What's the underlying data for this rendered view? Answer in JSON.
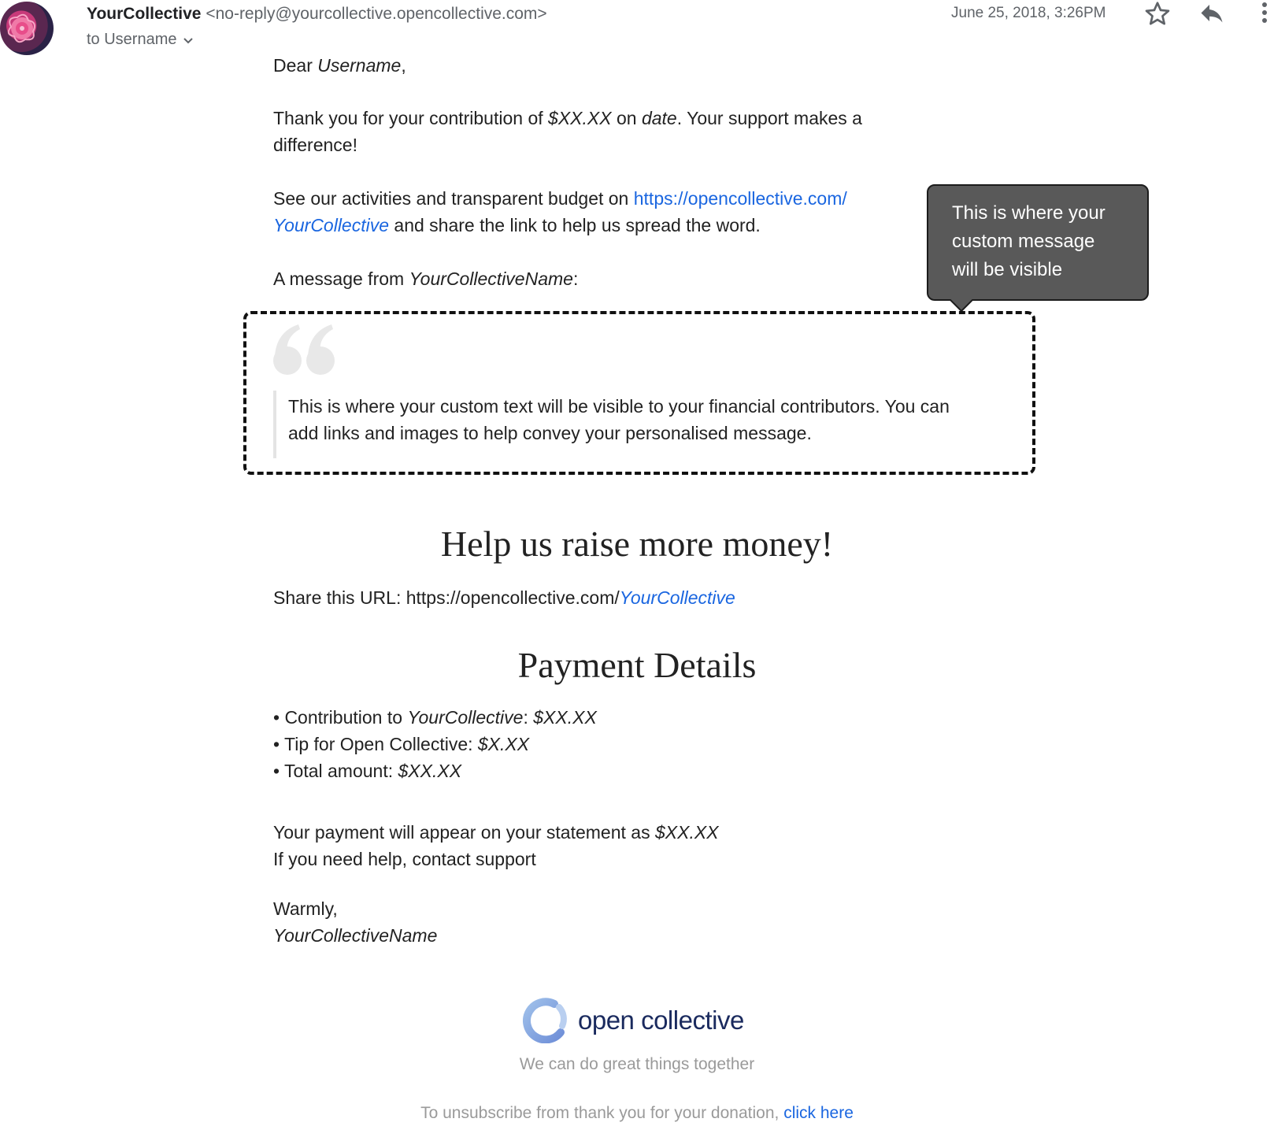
{
  "header": {
    "sender_name": "YourCollective",
    "sender_email": "<no-reply@yourcollective.opencollective.com>",
    "to_label": "to Username",
    "date": "June 25, 2018, 3:26PM"
  },
  "body": {
    "greeting_prefix": "Dear ",
    "greeting_name": "Username",
    "greeting_suffix": ",",
    "thanks_a": "Thank you for your contribution of ",
    "thanks_amount": "$XX.XX",
    "thanks_b": " on ",
    "thanks_date": "date",
    "thanks_c": ". Your support makes a",
    "thanks_d": "difference!",
    "see_a": "See our activities and transparent budget on ",
    "see_link_a": "https://opencollective.com/",
    "see_link_b": "YourCollective",
    "see_b": " and share the link to help us spread the word.",
    "msg_from_a": "A message from ",
    "msg_from_name": "YourCollectiveName",
    "msg_from_b": ":"
  },
  "tooltip": {
    "line1": "This is where your",
    "line2": "custom message",
    "line3": "will be visible"
  },
  "quote": {
    "line1": "This is where your custom text will be visible to your financial contributors. You can",
    "line2": "add links and images to help convey your personalised message."
  },
  "share": {
    "heading": "Help us raise more money!",
    "prefix": "Share this URL: https://opencollective.com/",
    "link": "YourCollective"
  },
  "payment": {
    "heading": "Payment Details",
    "items": [
      {
        "label": "• Contribution to ",
        "em": "YourCollective",
        "sep": ": ",
        "value": "$XX.XX"
      },
      {
        "label": "• Tip for Open Collective: ",
        "em": "",
        "sep": "",
        "value": "$X.XX"
      },
      {
        "label": "• Total amount: ",
        "em": "",
        "sep": "",
        "value": "$XX.XX"
      }
    ],
    "statement_a": "Your payment will appear on your statement as ",
    "statement_value": "$XX.XX",
    "help": "If you need help, contact support"
  },
  "closing": {
    "warmly": "Warmly,",
    "signature": "YourCollectiveName"
  },
  "footer": {
    "logo_text": "open collective",
    "tagline": "We can do great things together",
    "unsub_text": "To unsubscribe from thank you for your donation, ",
    "unsub_link": "click here"
  },
  "colors": {
    "link": "#1a66e0",
    "tooltip_bg": "#595959",
    "logo_text": "#1a2a5e"
  }
}
